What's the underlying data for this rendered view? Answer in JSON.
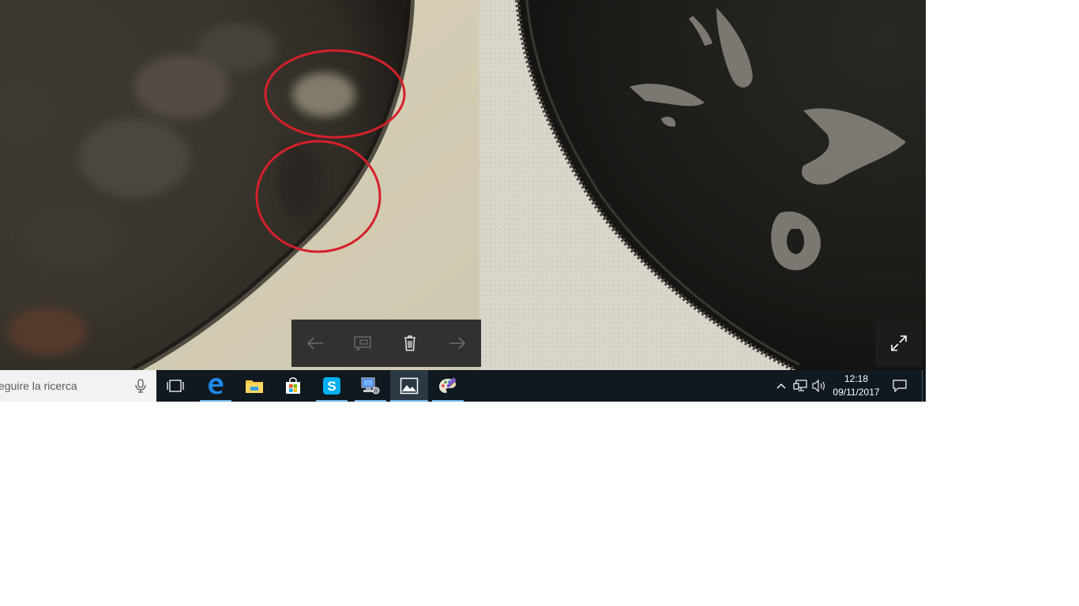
{
  "viewer": {
    "controls": {
      "previous_icon": "arrow-left-icon",
      "slideshow_icon": "slideshow-icon",
      "delete_icon": "trash-icon",
      "next_icon": "arrow-right-icon"
    },
    "fullscreen_icon": "expand-icon",
    "annotation_color": "#d5202a"
  },
  "taskbar": {
    "search": {
      "placeholder": "eguire la ricerca",
      "mic_icon": "microphone-icon"
    },
    "apps": [
      {
        "name": "Task View",
        "icon": "task-view-icon"
      },
      {
        "name": "Microsoft Edge",
        "icon": "edge-icon"
      },
      {
        "name": "File Explorer",
        "icon": "folder-icon"
      },
      {
        "name": "Store",
        "icon": "store-bag-icon"
      },
      {
        "name": "Skype",
        "icon": "skype-icon"
      },
      {
        "name": "Network App",
        "icon": "computer-network-icon"
      },
      {
        "name": "Photos",
        "icon": "photos-icon"
      },
      {
        "name": "Paint",
        "icon": "paint-palette-icon"
      }
    ],
    "tray": {
      "chevron_icon": "chevron-up-icon",
      "network_icon": "network-icon",
      "volume_icon": "volume-icon",
      "time": "12:18",
      "date": "09/11/2017",
      "notification_icon": "action-center-icon"
    },
    "accent_color": "#76b9ed"
  }
}
